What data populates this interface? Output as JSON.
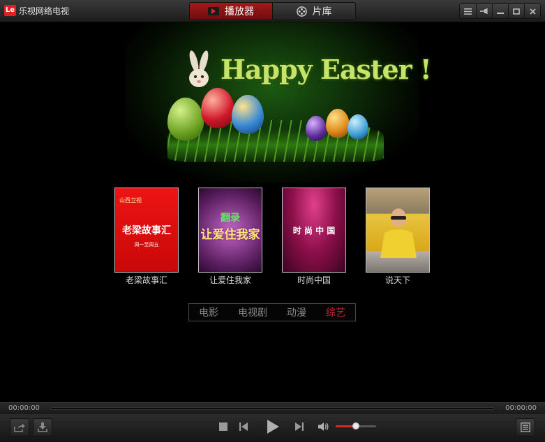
{
  "app": {
    "logo_text": "Le",
    "title": "乐视网络电视",
    "tabs": [
      {
        "label": "播放器",
        "icon": "play-icon",
        "active": true
      },
      {
        "label": "片库",
        "icon": "film-reel-icon",
        "active": false
      }
    ],
    "window_controls": [
      "menu-icon",
      "pin-icon",
      "minimize-icon",
      "maximize-icon",
      "close-icon"
    ]
  },
  "banner": {
    "text": "Happy Easter !"
  },
  "shows": [
    {
      "title": "老梁故事汇",
      "poster_text": "老梁故事汇",
      "poster_sub": "周一至周五",
      "poster_top": "山西卫视",
      "bg": "#e40d12"
    },
    {
      "title": "让爱住我家",
      "poster_text": "让爱住我家",
      "poster_top": "翻录",
      "bg": "#6a2a6e"
    },
    {
      "title": "时尚中国",
      "poster_text": "时 尚 中 国",
      "bg": "#8c0f4a"
    },
    {
      "title": "说天下",
      "poster_text": "",
      "bg": "#d9b64a"
    }
  ],
  "categories": [
    {
      "label": "电影",
      "active": false
    },
    {
      "label": "电视剧",
      "active": false
    },
    {
      "label": "动漫",
      "active": false
    },
    {
      "label": "综艺",
      "active": true
    }
  ],
  "player": {
    "current_time": "00:00:00",
    "total_time": "00:00:00",
    "progress": 0,
    "volume": 0.5
  },
  "colors": {
    "accent": "#c0282c",
    "tab_active": "#a3191c",
    "background": "#000000"
  }
}
